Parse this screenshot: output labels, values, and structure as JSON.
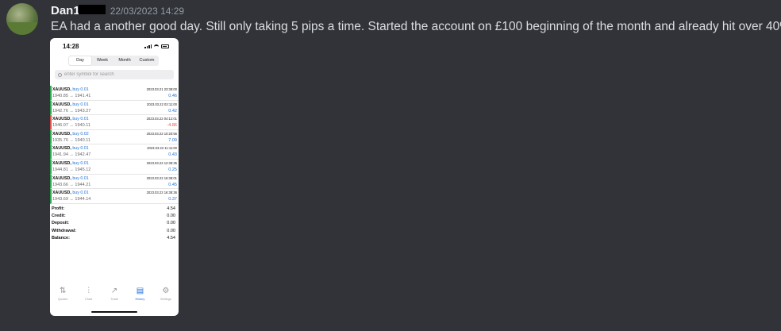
{
  "post": {
    "username": "Dan1",
    "timestamp": "22/03/2023 14:29",
    "message": "EA had a another good day. Still only taking 5 pips a time. Started the account on £100 beginning of the month and already hit over 40%"
  },
  "phone": {
    "status_time": "14:28",
    "tabs": [
      "Day",
      "Week",
      "Month",
      "Custom"
    ],
    "active_tab": "Day",
    "search_placeholder": "enter symbol for search",
    "trades": [
      {
        "symbol": "XAUUSD,",
        "side": "buy 0.01",
        "prices": "1940.85 → 1941.41",
        "datetime": "2023.03.21 23:38:00",
        "profit": "0.46"
      },
      {
        "symbol": "XAUUSD,",
        "side": "buy 0.01",
        "prices": "1942.76 → 1943.27",
        "datetime": "2023.03.22 02:11:00",
        "profit": "0.42"
      },
      {
        "symbol": "XAUUSD,",
        "side": "buy 0.01",
        "prices": "1946.07 → 1940.11",
        "datetime": "2023.03.22 04:12:01",
        "profit": "-4.86"
      },
      {
        "symbol": "XAUUSD,",
        "side": "buy 0.02",
        "prices": "1935.76 → 1940.11",
        "datetime": "2023.03.22 10:20:56",
        "profit": "7.09"
      },
      {
        "symbol": "XAUUSD,",
        "side": "buy 0.01",
        "prices": "1941.94 → 1942.47",
        "datetime": "2023.03.22 11:11:00",
        "profit": "0.43"
      },
      {
        "symbol": "XAUUSD,",
        "side": "buy 0.01",
        "prices": "1944.81 → 1945.12",
        "datetime": "2023.03.22 12:36:35",
        "profit": "0.25"
      },
      {
        "symbol": "XAUUSD,",
        "side": "buy 0.01",
        "prices": "1943.66 → 1944.21",
        "datetime": "2023.03.22 16:38:01",
        "profit": "0.45"
      },
      {
        "symbol": "XAUUSD,",
        "side": "buy 0.01",
        "prices": "1943.69 → 1944.14",
        "datetime": "2023.03.22 16:38:36",
        "profit": "0.37"
      }
    ],
    "summary": [
      {
        "label": "Profit:",
        "value": "4.54"
      },
      {
        "label": "Credit:",
        "value": "0.00"
      },
      {
        "label": "Deposit:",
        "value": "0.00"
      },
      {
        "label": "Withdrawal:",
        "value": "0.00"
      },
      {
        "label": "Balance:",
        "value": "4.54"
      }
    ],
    "nav": [
      {
        "label": "Quotes",
        "icon": "quotes-icon",
        "glyph": "⇅"
      },
      {
        "label": "Chart",
        "icon": "chart-icon",
        "glyph": "⫶"
      },
      {
        "label": "Trade",
        "icon": "trade-icon",
        "glyph": "↗"
      },
      {
        "label": "History",
        "icon": "history-icon",
        "glyph": "▤"
      },
      {
        "label": "Settings",
        "icon": "settings-icon",
        "glyph": "⚙"
      }
    ],
    "active_nav": "History",
    "colors": {
      "profit": "#1e6fd9",
      "loss": "#d9534f",
      "background": "#313338"
    }
  }
}
